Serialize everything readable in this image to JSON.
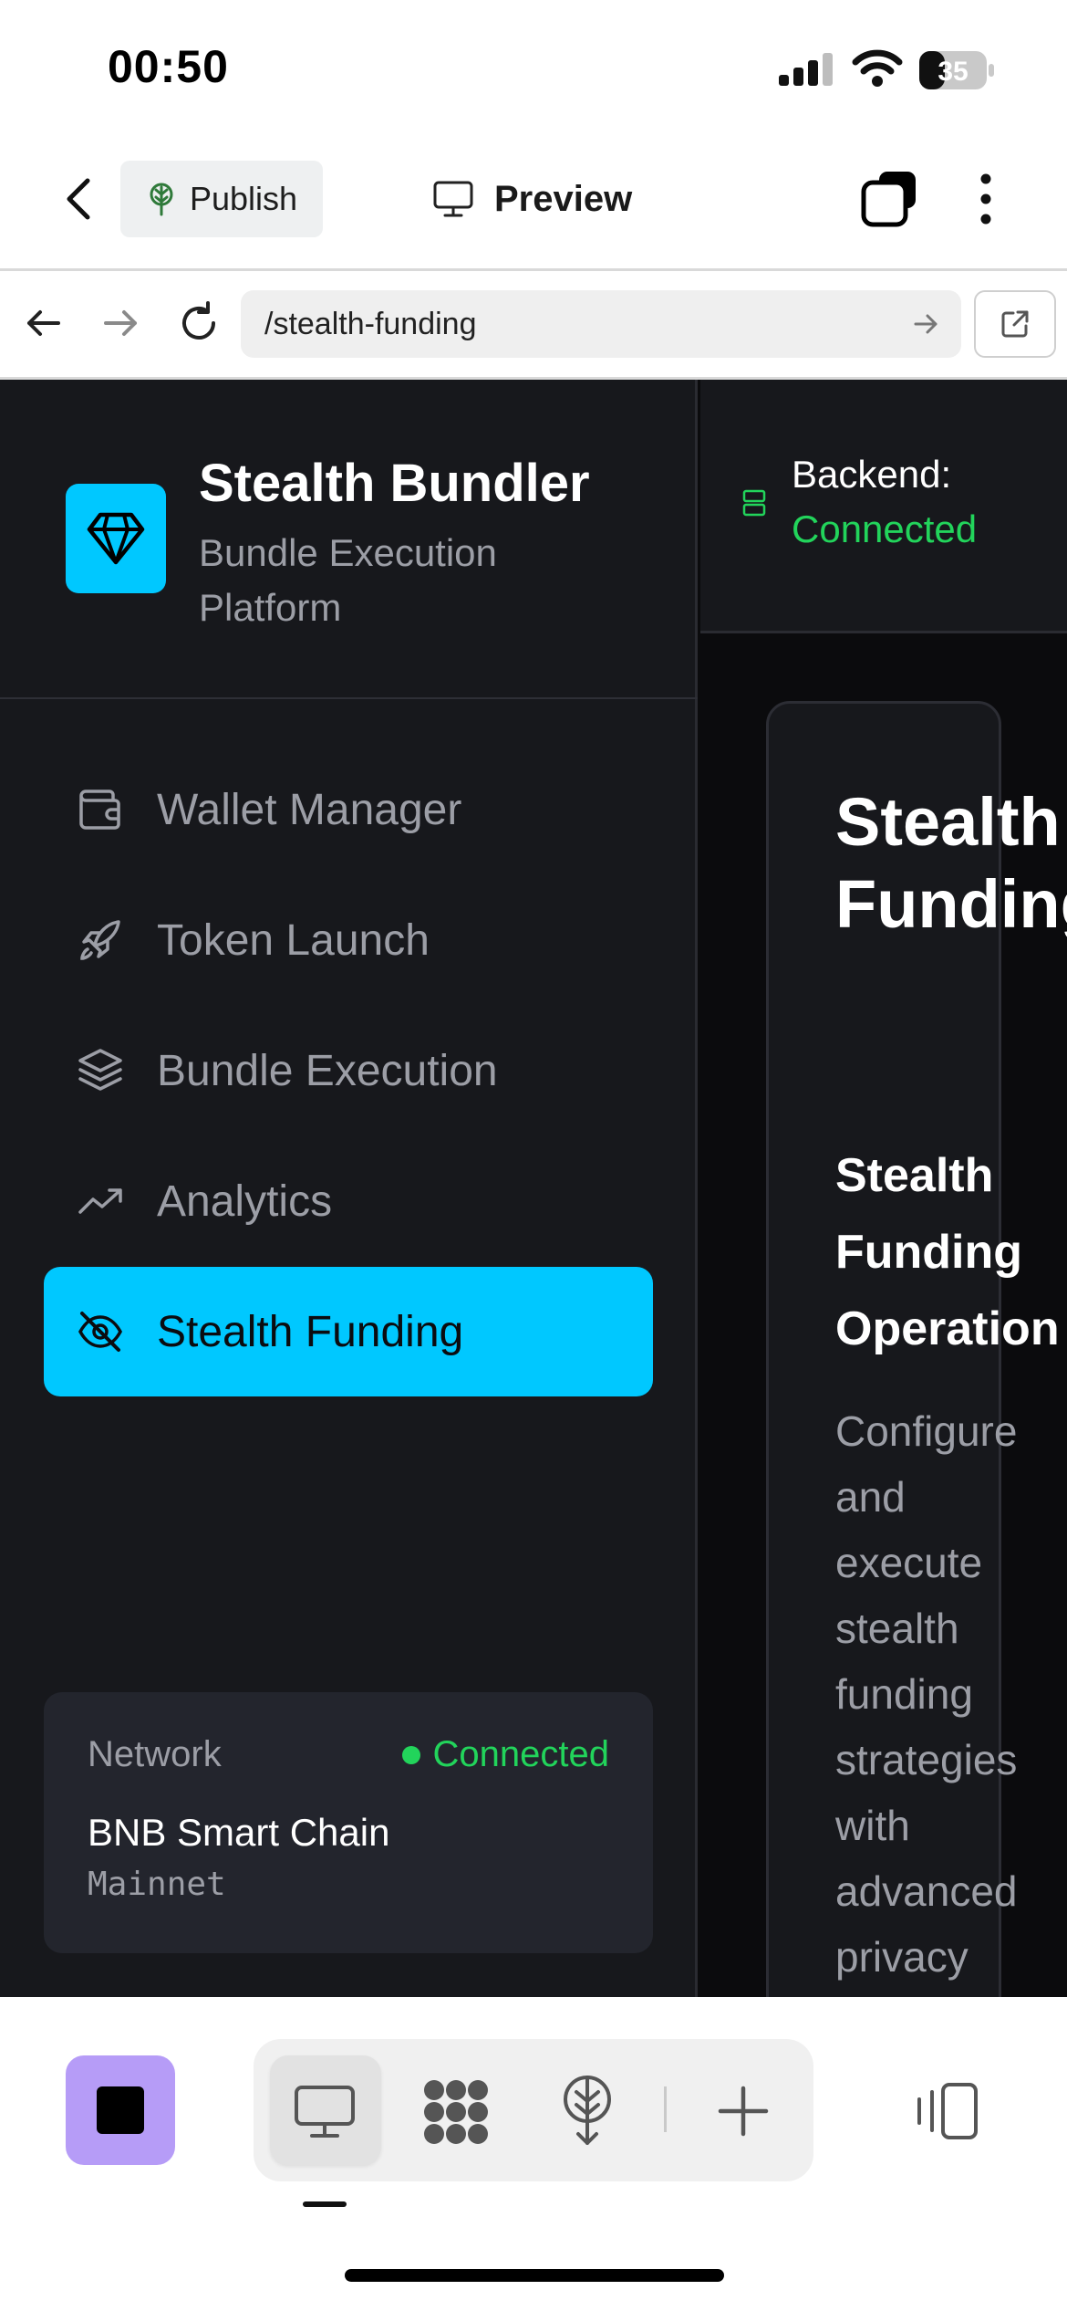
{
  "status_bar": {
    "time": "00:50",
    "battery": "35"
  },
  "header": {
    "publish_label": "Publish",
    "preview_label": "Preview"
  },
  "browser": {
    "url": "/stealth-funding"
  },
  "sidebar": {
    "brand_title": "Stealth Bundler",
    "brand_subtitle": "Bundle Execution Platform",
    "items": [
      {
        "label": "Wallet Manager",
        "icon": "wallet-icon",
        "active": false
      },
      {
        "label": "Token Launch",
        "icon": "rocket-icon",
        "active": false
      },
      {
        "label": "Bundle Execution",
        "icon": "layers-icon",
        "active": false
      },
      {
        "label": "Analytics",
        "icon": "trending-up-icon",
        "active": false
      },
      {
        "label": "Stealth Funding",
        "icon": "eye-off-icon",
        "active": true
      }
    ],
    "network": {
      "label": "Network",
      "status": "Connected",
      "chain": "BNB Smart Chain",
      "type": "Mainnet"
    }
  },
  "topbar": {
    "backend_label": "Backend:",
    "backend_status": "Connected"
  },
  "main": {
    "title": "Stealth Funding",
    "card_title": "Stealth Funding Operation",
    "card_description": "Configure and execute stealth funding strategies with advanced privacy"
  },
  "colors": {
    "accent": "#00c8ff",
    "success": "#22d45b",
    "sidebar_bg": "#17181c",
    "stop_button": "#b69cf7"
  }
}
